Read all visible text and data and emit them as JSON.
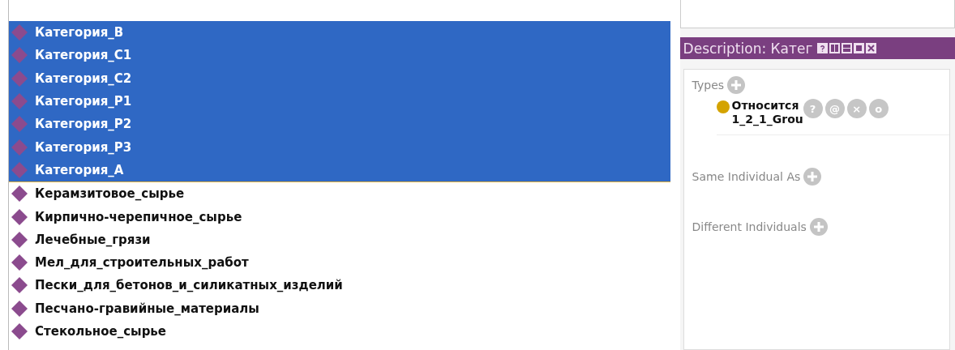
{
  "individuals": [
    {
      "label": "Категория_B",
      "selected": true
    },
    {
      "label": "Категория_C1",
      "selected": true
    },
    {
      "label": "Категория_C2",
      "selected": true
    },
    {
      "label": "Категория_P1",
      "selected": true
    },
    {
      "label": "Категория_P2",
      "selected": true
    },
    {
      "label": "Категория_P3",
      "selected": true
    },
    {
      "label": "Категория_A",
      "selected": true
    },
    {
      "label": "Керамзитовое_сырье",
      "selected": false
    },
    {
      "label": "Кирпично-черепичное_сырье",
      "selected": false
    },
    {
      "label": "Лечебные_грязи",
      "selected": false
    },
    {
      "label": "Мел_для_строительных_работ",
      "selected": false
    },
    {
      "label": "Пески_для_бетонов_и_силикатных_изделий",
      "selected": false
    },
    {
      "label": "Песчано-гравийные_материалы",
      "selected": false
    },
    {
      "label": "Стекольное_сырье",
      "selected": false
    }
  ],
  "description": {
    "title": "Description: Катег",
    "sections": [
      {
        "label": "Types",
        "entries": [
          {
            "label_lines": [
              "Относится",
              "1_2_1_Grou"
            ],
            "buttons": [
              "?",
              "@",
              "×",
              "o"
            ]
          }
        ]
      },
      {
        "label": "Same Individual As"
      },
      {
        "label": "Different Individuals"
      }
    ]
  }
}
